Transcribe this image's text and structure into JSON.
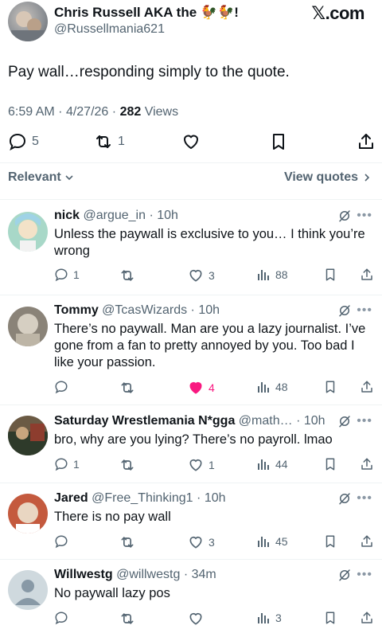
{
  "header": {
    "brand": "𝕏.com",
    "author_name": "Chris Russell AKA the 🐓🐓!",
    "author_handle": "@Russellmania621",
    "post_text": "Pay wall…responding simply to the quote.",
    "time": "6:59 AM",
    "date": "4/27/26",
    "views_count": "282",
    "views_label": "Views",
    "reply_count": "5",
    "repost_count": "1"
  },
  "sort": {
    "label": "Relevant",
    "view_quotes": "View quotes"
  },
  "colors": {
    "like_active": "#f91880",
    "muted": "#536471"
  },
  "replies": [
    {
      "name": "nick",
      "handle": "@argue_in",
      "time": "10h",
      "text": "Unless the paywall is exclusive to you… I think you’re wrong",
      "replies": "1",
      "reposts": "",
      "likes": "3",
      "liked": false,
      "views": "88"
    },
    {
      "name": "Tommy",
      "handle": "@TcasWizards",
      "time": "10h",
      "text": "There’s no paywall.  Man are you a lazy journalist.  I’ve gone from a fan to pretty annoyed by you.  Too bad I like your passion.",
      "replies": "",
      "reposts": "",
      "likes": "4",
      "liked": true,
      "views": "48"
    },
    {
      "name": "Saturday Wrestlemania N*gga",
      "handle": "@math…",
      "time": "10h",
      "text": "bro, why are you lying? There’s no payroll. lmao",
      "replies": "1",
      "reposts": "",
      "likes": "1",
      "liked": false,
      "views": "44"
    },
    {
      "name": "Jared",
      "handle": "@Free_Thinking1",
      "time": "10h",
      "text": "There is no pay wall",
      "replies": "",
      "reposts": "",
      "likes": "3",
      "liked": false,
      "views": "45"
    },
    {
      "name": "Willwestg",
      "handle": "@willwestg",
      "time": "34m",
      "text": "No paywall lazy pos",
      "replies": "",
      "reposts": "",
      "likes": "",
      "liked": false,
      "views": "3"
    }
  ]
}
